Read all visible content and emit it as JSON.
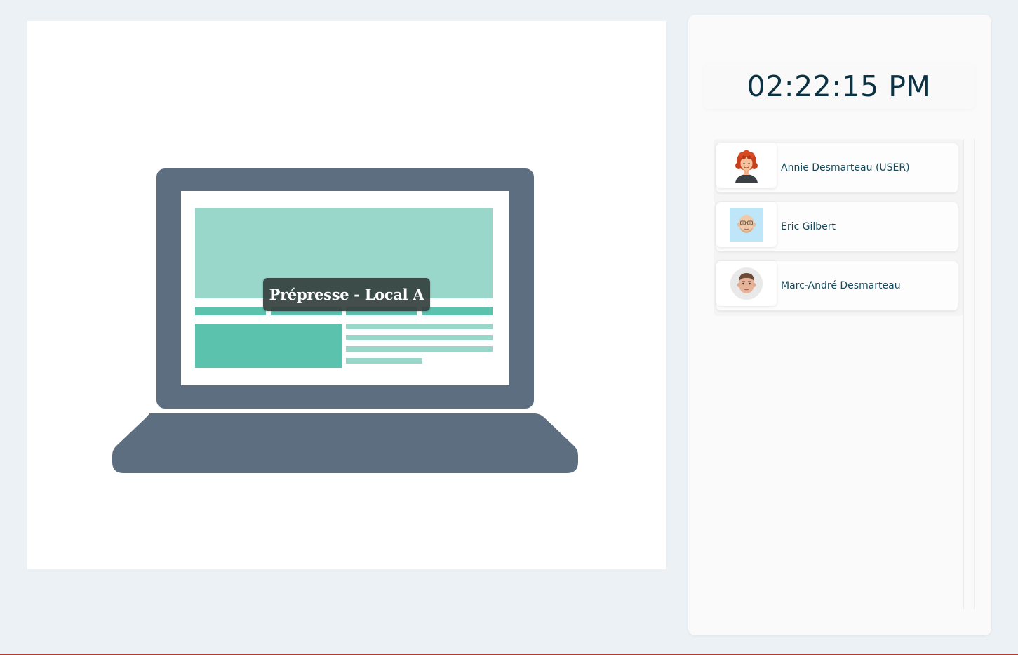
{
  "room": {
    "name": "Prépresse - Local A",
    "device_icon": "laptop-icon",
    "colors": {
      "device_frame": "#5d6e80",
      "screen_primary": "#5bc2ae",
      "screen_light": "#9ad7cb"
    }
  },
  "clock": {
    "time": "02:22:15 PM"
  },
  "users": [
    {
      "name": "Annie Desmarteau (USER)",
      "avatar": "memoji-red-curly-hair-woman-avatar"
    },
    {
      "name": "Eric Gilbert",
      "avatar": "memoji-bald-man-glasses-avatar"
    },
    {
      "name": "Marc-André Desmarteau",
      "avatar": "memoji-brown-hair-man-avatar"
    }
  ],
  "colors": {
    "background": "#ecf1f6",
    "clock_text": "#0b3142",
    "user_text": "#134a5c"
  }
}
